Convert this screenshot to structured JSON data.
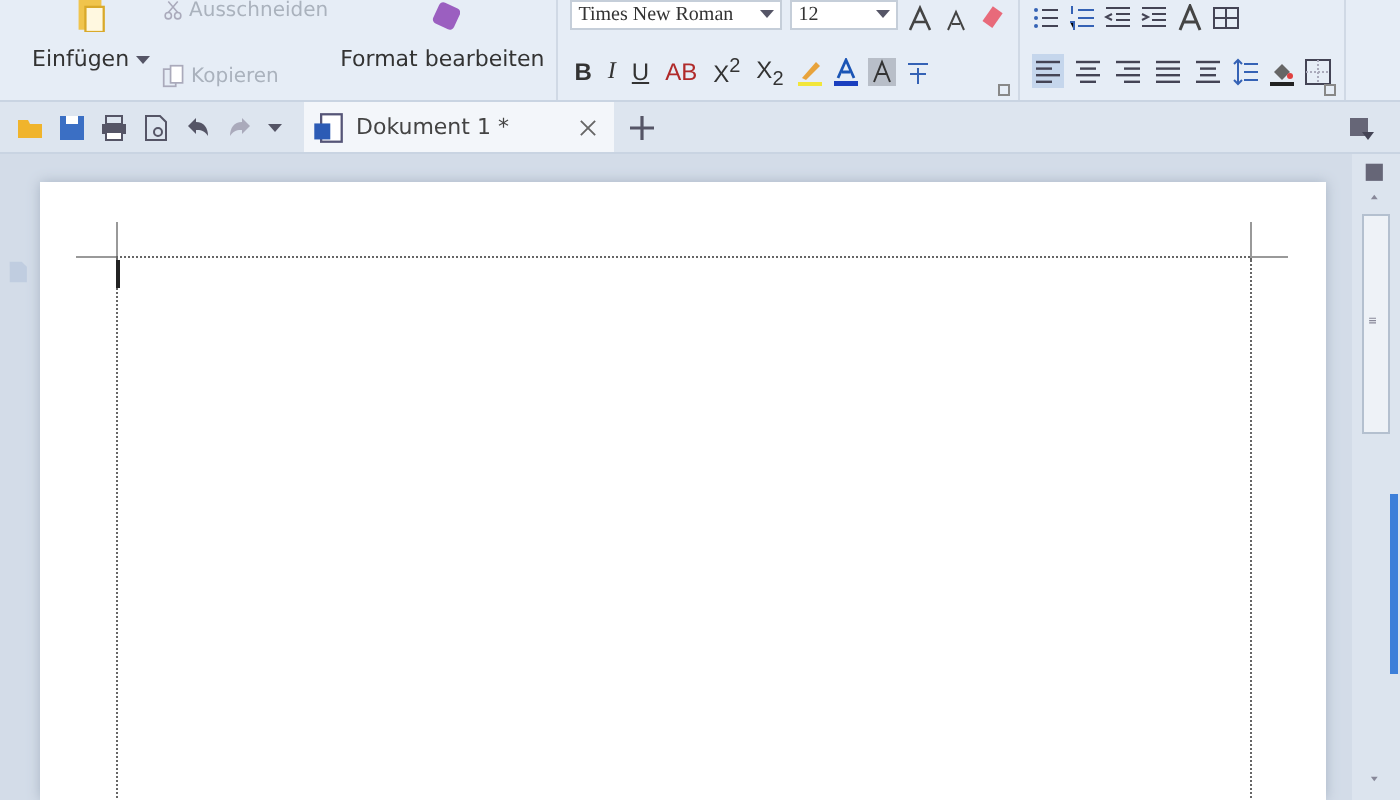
{
  "clipboard": {
    "paste": "Einfügen",
    "cut": {
      "label": "Ausschneiden",
      "disabled": true
    },
    "copy": {
      "label": "Kopieren",
      "disabled": true
    },
    "format_painter": "Format bearbeiten"
  },
  "font": {
    "family": "Times New Roman",
    "size": "12",
    "format_buttons": [
      {
        "kind": "bold",
        "label": "B"
      },
      {
        "kind": "italic",
        "label": "I"
      },
      {
        "kind": "underline",
        "label": "U"
      },
      {
        "kind": "strike",
        "label": "AB"
      },
      {
        "kind": "script",
        "label": "X$^{2}$"
      },
      {
        "kind": "script",
        "label": "X$_{2}$"
      }
    ]
  },
  "paragraph": {
    "alignments": [
      {
        "kind": "left",
        "selected": true
      },
      {
        "kind": "center",
        "selected": false
      },
      {
        "kind": "right",
        "selected": false
      },
      {
        "kind": "justify",
        "selected": false
      },
      {
        "kind": "distributed",
        "selected": false
      }
    ]
  },
  "tabs": [
    {
      "label": "Dokument 1 *",
      "selected": true
    }
  ]
}
